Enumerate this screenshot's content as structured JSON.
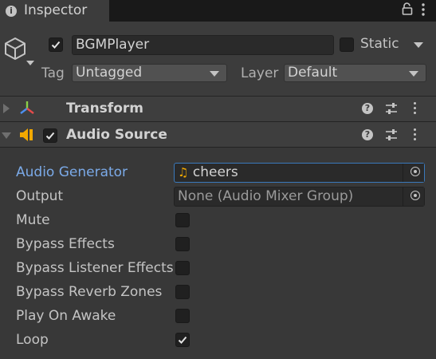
{
  "tab": {
    "title": "Inspector",
    "icon": "info-icon"
  },
  "header": {
    "enabled": true,
    "name": "BGMPlayer",
    "static_label": "Static",
    "static_checked": false,
    "tag_label": "Tag",
    "tag_value": "Untagged",
    "layer_label": "Layer",
    "layer_value": "Default"
  },
  "components": [
    {
      "name": "Transform",
      "expanded": false,
      "icon": "transform-icon"
    },
    {
      "name": "Audio Source",
      "expanded": true,
      "enabled": true,
      "icon": "speaker-icon"
    }
  ],
  "audio_source": {
    "generator_label": "Audio Generator",
    "generator_value": "cheers",
    "output_label": "Output",
    "output_value": "None (Audio Mixer Group)",
    "toggles": [
      {
        "label": "Mute",
        "checked": false
      },
      {
        "label": "Bypass Effects",
        "checked": false
      },
      {
        "label": "Bypass Listener Effects",
        "checked": false
      },
      {
        "label": "Bypass Reverb Zones",
        "checked": false
      },
      {
        "label": "Play On Awake",
        "checked": false
      },
      {
        "label": "Loop",
        "checked": true
      }
    ]
  },
  "colors": {
    "accent": "#7baae8",
    "focus_border": "#3a79bb",
    "background": "#383838"
  }
}
